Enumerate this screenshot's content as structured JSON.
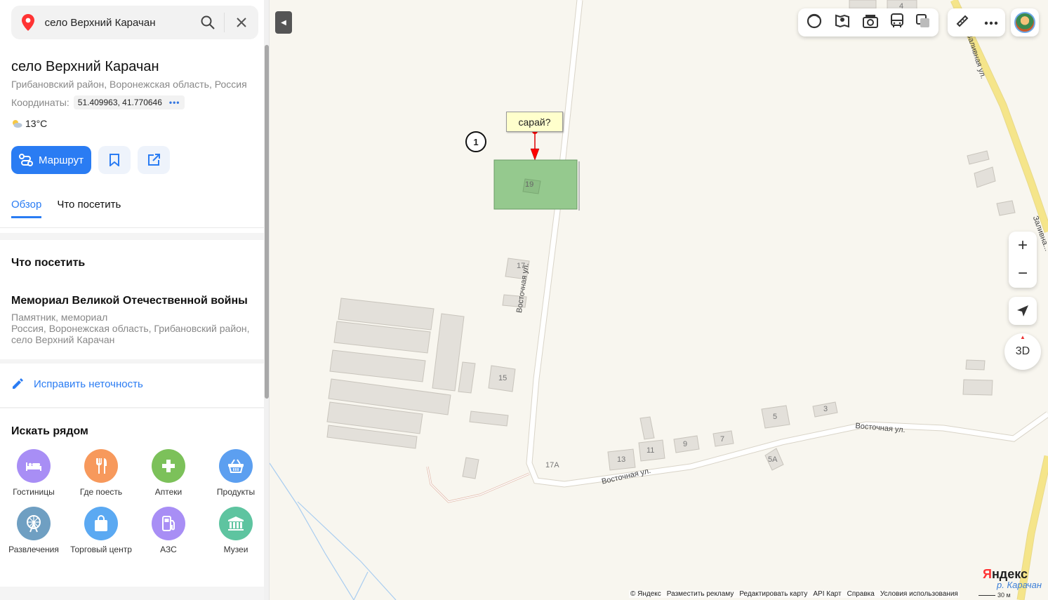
{
  "search": {
    "value": "село Верхний Карачан"
  },
  "place": {
    "title": "село Верхний Карачан",
    "subtitle": "Грибановский район, Воронежская область, Россия",
    "coords_label": "Координаты:",
    "coords_value": "51.409963, 41.770646",
    "temperature": "13°C"
  },
  "actions": {
    "route_label": "Маршрут"
  },
  "tabs": [
    {
      "label": "Обзор",
      "active": true
    },
    {
      "label": "Что посетить",
      "active": false
    }
  ],
  "visit": {
    "heading": "Что посетить",
    "poi_name": "Мемориал Великой Отечественной войны",
    "poi_type": "Памятник, мемориал",
    "poi_address": "Россия, Воронежская область, Грибановский район, село Верхний Карачан"
  },
  "fix_label": "Исправить неточность",
  "nearby": {
    "heading": "Искать рядом",
    "categories": [
      {
        "label": "Гостиницы",
        "icon": "bed-icon",
        "color": "#a88ef5"
      },
      {
        "label": "Где поесть",
        "icon": "fork-knife-icon",
        "color": "#f7995c"
      },
      {
        "label": "Аптеки",
        "icon": "cross-icon",
        "color": "#7cc15a"
      },
      {
        "label": "Продукты",
        "icon": "basket-icon",
        "color": "#5c9ff0"
      },
      {
        "label": "Развлечения",
        "icon": "ferris-wheel-icon",
        "color": "#6f9fc2"
      },
      {
        "label": "Торговый центр",
        "icon": "shopping-bag-icon",
        "color": "#5ba9f2"
      },
      {
        "label": "АЗС",
        "icon": "fuel-icon",
        "color": "#a88ef5"
      },
      {
        "label": "Музеи",
        "icon": "museum-icon",
        "color": "#5ec4a0"
      }
    ]
  },
  "map": {
    "callout_text": "сарай?",
    "circle_label": "1",
    "streets": {
      "east_1": "Восточная ул.",
      "east_2": "Восточная ул.",
      "east_3": "Восточная ул.",
      "zalivnaya_1": "Заливная ул.",
      "zalivnaya_2": "Заливна..."
    },
    "house_numbers": {
      "h19": "19",
      "h17": "17",
      "h15": "15",
      "h17a": "17А",
      "h13": "13",
      "h11": "11",
      "h9": "9",
      "h7": "7",
      "h5": "5",
      "h5a": "5А",
      "h3": "3",
      "h4": "4"
    },
    "controls": {
      "zoom_in": "+",
      "zoom_out": "−",
      "btn3d": "3D"
    },
    "footer": [
      "© Яндекс",
      "Разместить рекламу",
      "Редактировать карту",
      "API Карт",
      "Справка",
      "Условия использования"
    ],
    "logo_part1": "Я",
    "logo_part2": "ндекс",
    "river": "р. Карачан",
    "scale": "30 м",
    "highlight_color": "#95c98e",
    "road_color": "#f5e58a"
  }
}
